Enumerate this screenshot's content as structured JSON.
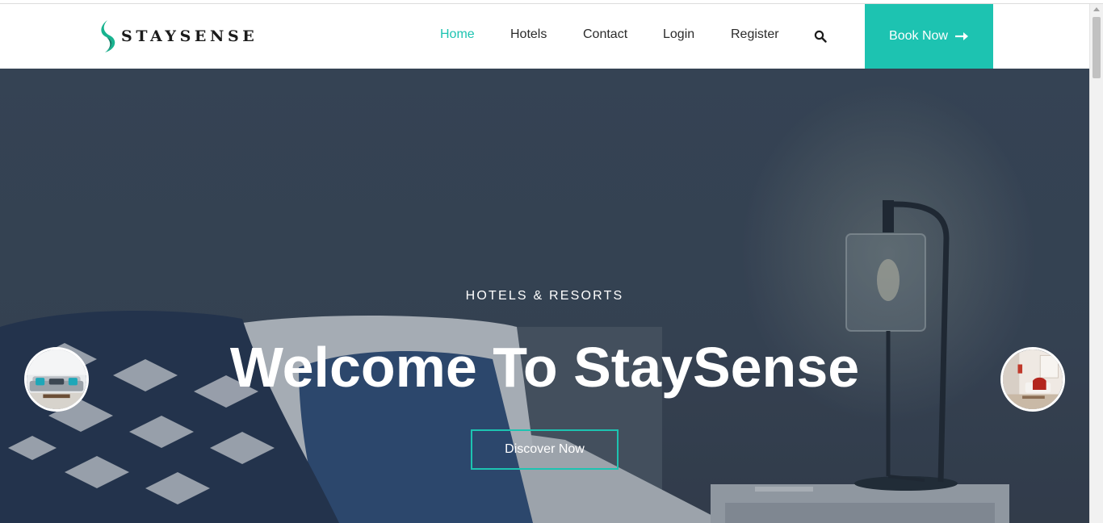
{
  "brand": {
    "name": "STAYSENSE",
    "accent_color": "#1dc3b1",
    "icon": "leaf-logo-icon"
  },
  "nav": {
    "items": [
      {
        "label": "Home",
        "active": true
      },
      {
        "label": "Hotels",
        "active": false
      },
      {
        "label": "Contact",
        "active": false
      },
      {
        "label": "Login",
        "active": false
      },
      {
        "label": "Register",
        "active": false
      }
    ],
    "search_icon": "search-icon",
    "book_button": {
      "label": "Book Now",
      "icon": "arrow-right-icon"
    }
  },
  "hero": {
    "subtitle": "HOTELS & RESORTS",
    "title": "Welcome To StaySense",
    "cta_label": "Discover Now",
    "prev_thumb": "living-room-thumbnail",
    "next_thumb": "bedroom-thumbnail"
  }
}
